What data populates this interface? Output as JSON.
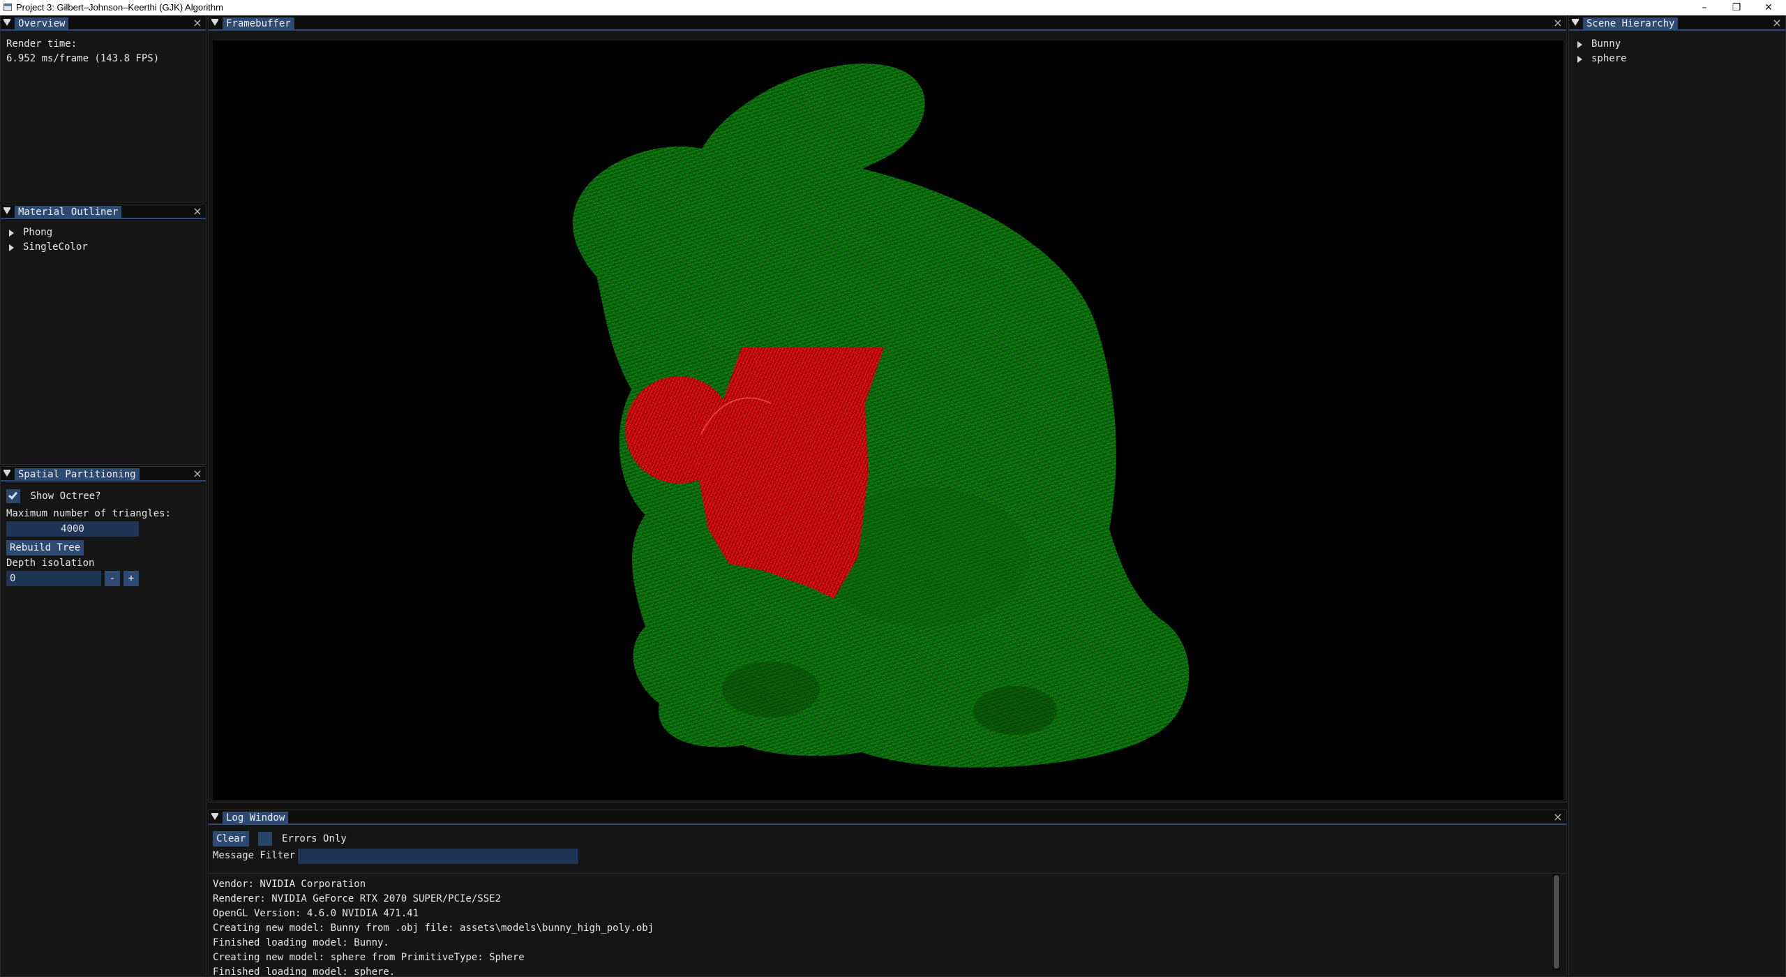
{
  "os_window": {
    "title": "Project 3: Gilbert–Johnson–Keerthi (GJK) Algorithm",
    "minimize_glyph": "–",
    "restore_glyph": "❐",
    "close_glyph": "✕"
  },
  "overview": {
    "tab": "Overview",
    "render_time_label": "Render time:",
    "render_time_value": "6.952 ms/frame (143.8 FPS)"
  },
  "material_outliner": {
    "tab": "Material Outliner",
    "items": [
      "Phong",
      "SingleColor"
    ]
  },
  "spatial_partitioning": {
    "tab": "Spatial Partitioning",
    "show_octree_label": "Show Octree?",
    "show_octree_checked": true,
    "max_triangles_label": "Maximum number of triangles:",
    "max_triangles_value": "4000",
    "rebuild_button": "Rebuild Tree",
    "depth_isolation_label": "Depth isolation",
    "depth_isolation_value": "0",
    "minus_label": "-",
    "plus_label": "+"
  },
  "framebuffer": {
    "tab": "Framebuffer",
    "bunny_color": "#0d8a0d",
    "sphere_color": "#ff1a1a",
    "background": "#000000"
  },
  "scene_hierarchy": {
    "tab": "Scene Hierarchy",
    "items": [
      "Bunny",
      "sphere"
    ]
  },
  "log_window": {
    "tab": "Log Window",
    "clear_button": "Clear",
    "errors_only_label": "Errors Only",
    "errors_only_checked": false,
    "message_filter_label": "Message Filter",
    "message_filter_value": "",
    "lines": [
      "Vendor: NVIDIA Corporation",
      "Renderer: NVIDIA GeForce RTX 2070 SUPER/PCIe/SSE2",
      "OpenGL Version: 4.6.0 NVIDIA 471.41",
      "Creating new model: Bunny from .obj file: assets\\models\\bunny_high_poly.obj",
      "Finished loading model: Bunny.",
      "Creating new model: sphere from PrimitiveType: Sphere",
      "Finished loading model: sphere."
    ]
  },
  "icons": {
    "panel_collapse": "collapse-triangle-icon",
    "panel_close": "close-icon",
    "tree_expand": "tree-expand-arrow-icon",
    "checkbox_tick": "checkmark-icon"
  },
  "theme": {
    "tab_active": "#2d4a73",
    "panel_bg": "#151515",
    "input_bg": "#1e3556"
  }
}
